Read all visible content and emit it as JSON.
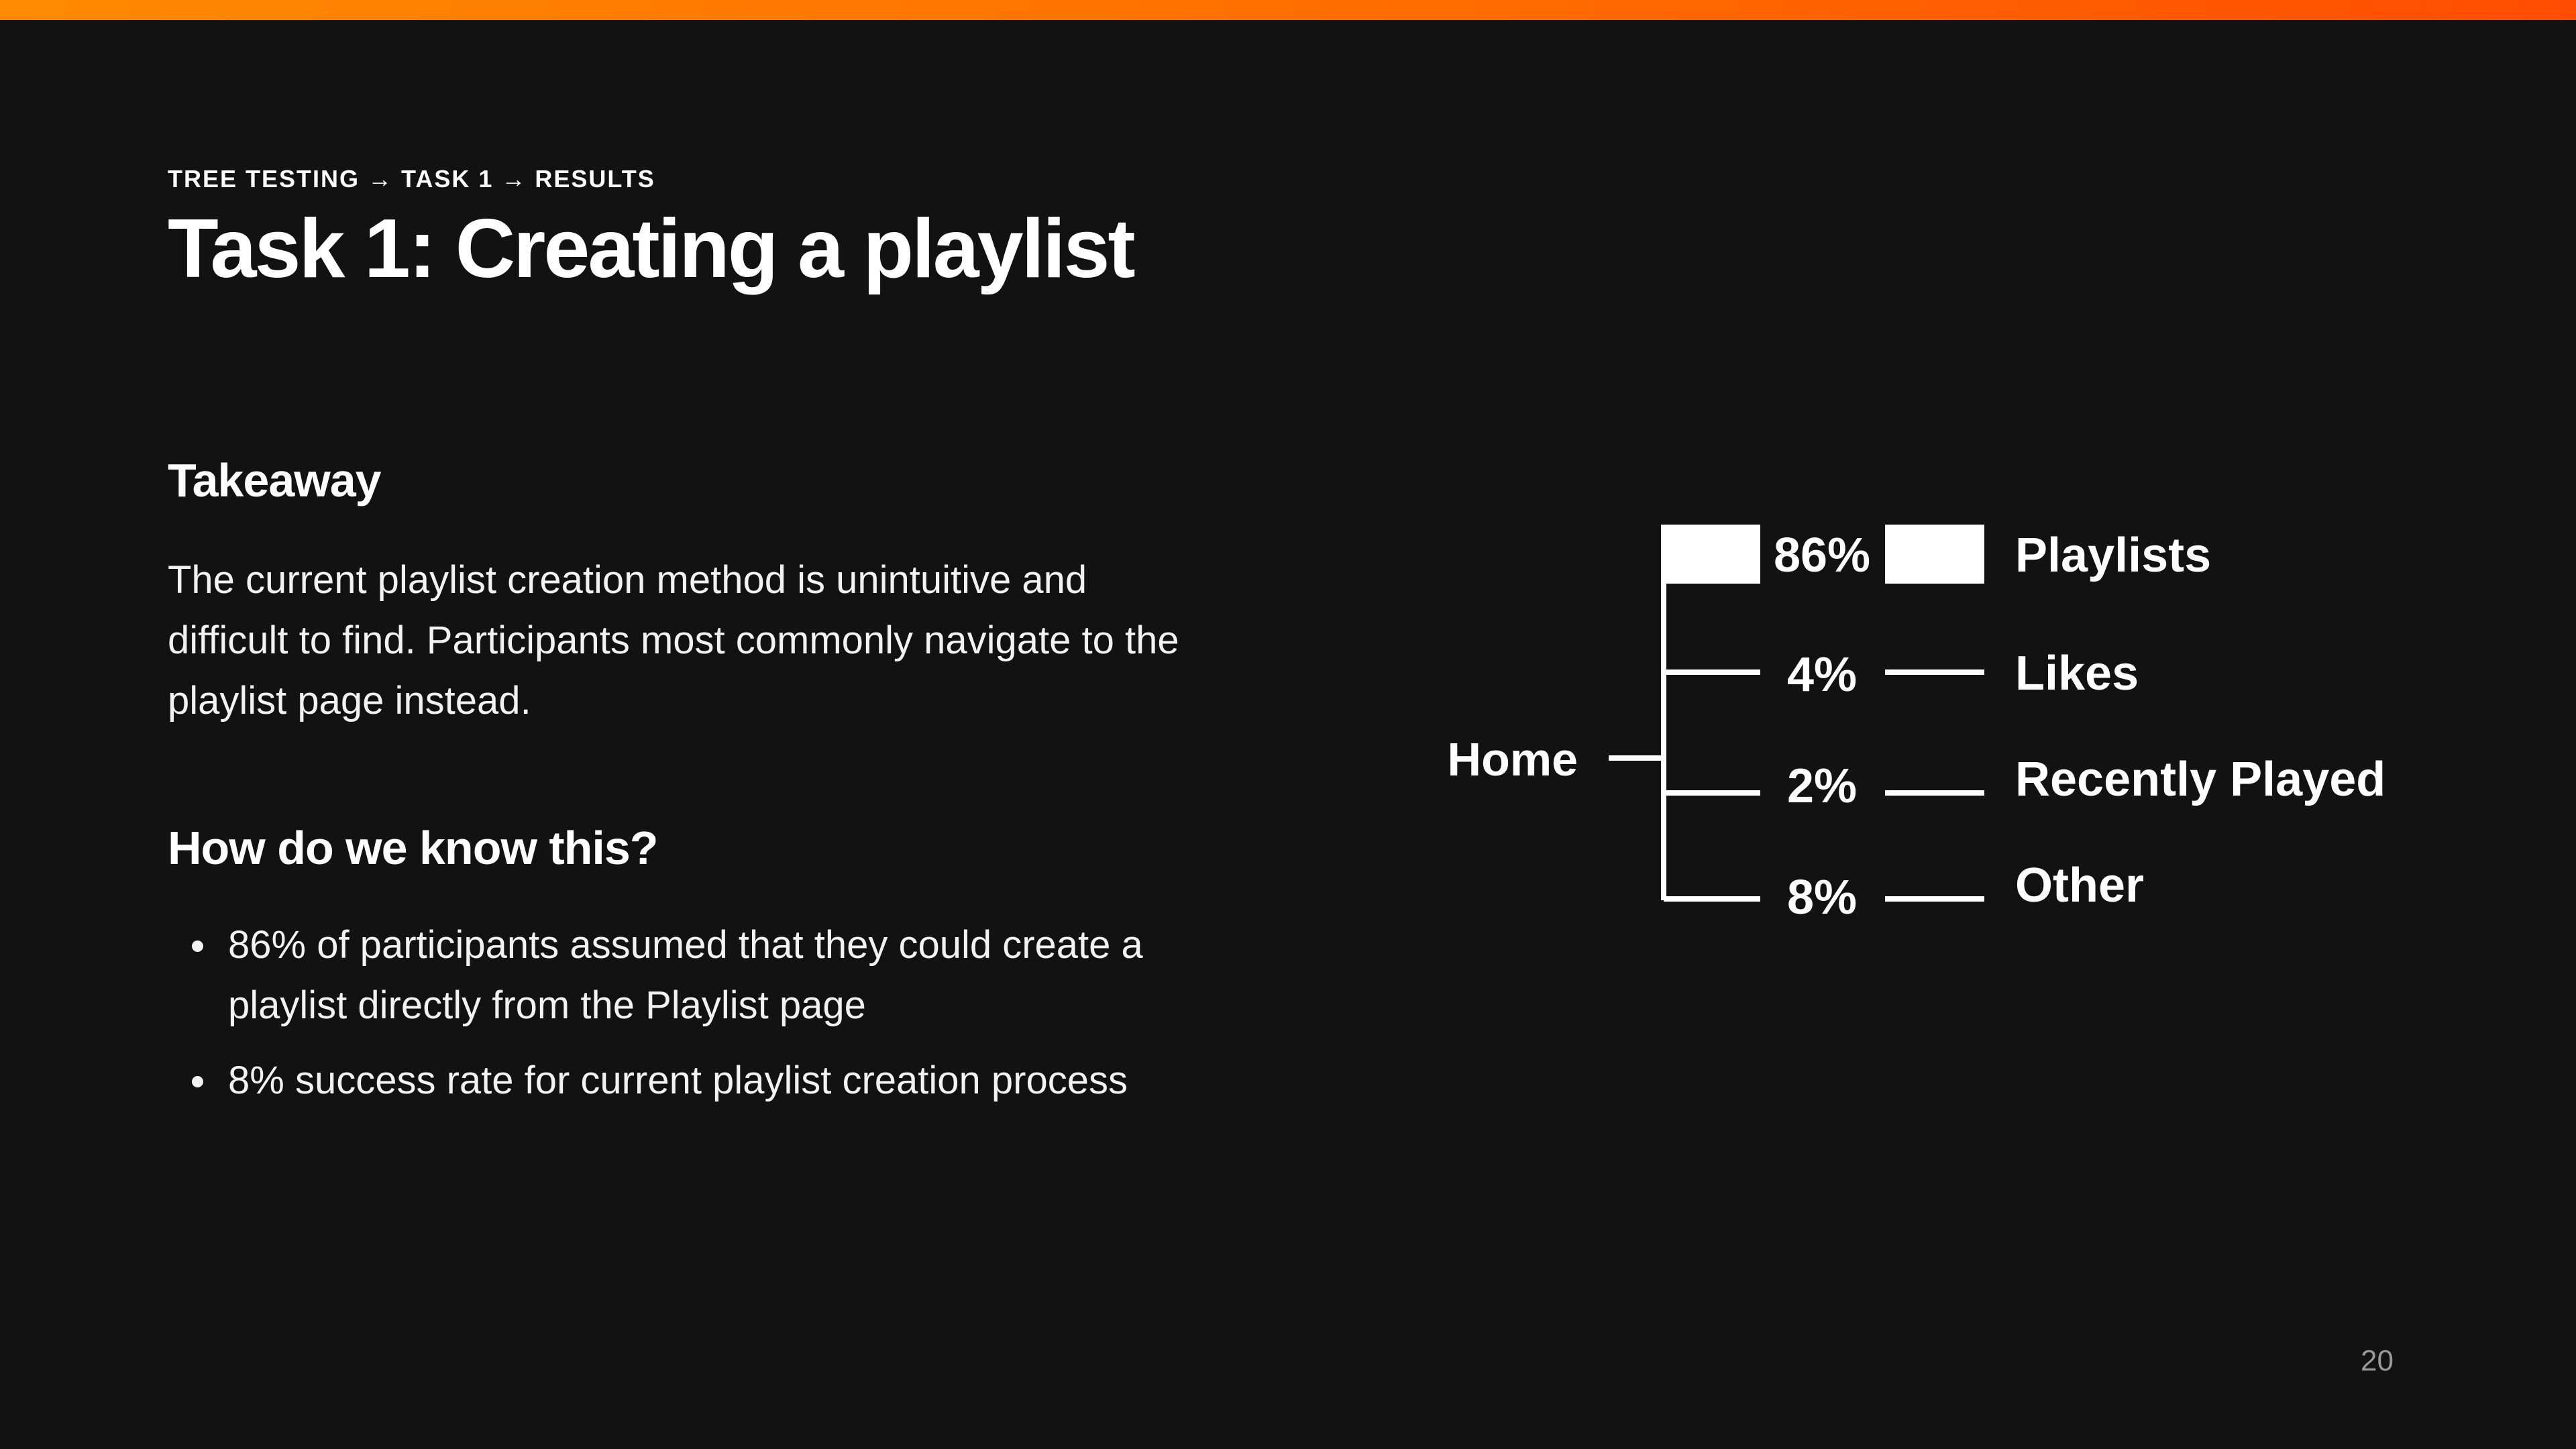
{
  "slide": {
    "breadcrumb": [
      "TREE TESTING",
      "TASK 1",
      "RESULTS"
    ],
    "breadcrumb_separator": "→",
    "title": "Task 1: Creating a playlist",
    "page_number": "20",
    "accent_gradient": [
      "#ff8a00",
      "#ff4d00"
    ],
    "background": "#121212"
  },
  "takeaway": {
    "heading": "Takeaway",
    "body": "The current playlist creation method is unintuitive and difficult to find. Participants most commonly navigate to the playlist page instead."
  },
  "evidence": {
    "heading": "How do we know this?",
    "bullets": [
      "86% of participants assumed that they could create a playlist directly from the Playlist page",
      "8% success rate for current playlist creation process"
    ]
  },
  "tree": {
    "root": "Home",
    "branches": [
      {
        "label": "Playlists",
        "percent": "86%",
        "value": 86
      },
      {
        "label": "Likes",
        "percent": "4%",
        "value": 4
      },
      {
        "label": "Recently Played",
        "percent": "2%",
        "value": 2
      },
      {
        "label": "Other",
        "percent": "8%",
        "value": 8
      }
    ]
  }
}
